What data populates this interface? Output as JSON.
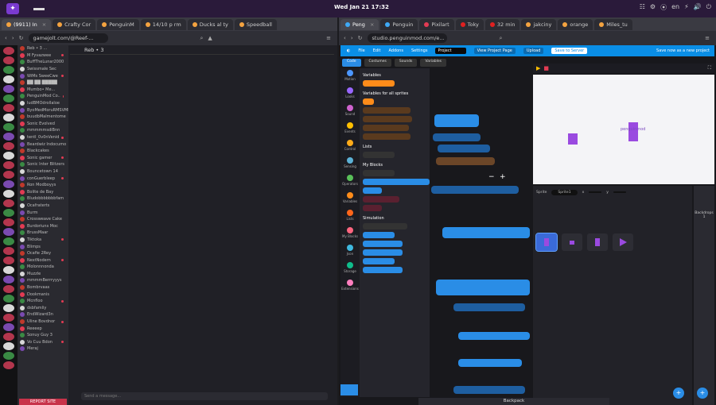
{
  "topbar": {
    "clock": "Wed Jan 21 17:32",
    "tray_items": [
      "☷",
      "⚙",
      "⦿",
      "en",
      "⚡",
      "🔊",
      "⏻"
    ]
  },
  "left_browser": {
    "tabs": [
      {
        "label": "(9911) In",
        "active": true
      },
      {
        "label": "Crafty Cor",
        "active": false
      },
      {
        "label": "PenguinM",
        "active": false
      },
      {
        "label": "14/10 p rm",
        "active": false
      },
      {
        "label": "Ducks al ty",
        "active": false
      },
      {
        "label": "Speedball",
        "active": false
      }
    ],
    "url": "gamejolt.com/@Reef-...",
    "channel_header": "Reb • 3",
    "channels": [
      "Reb • 3 ...",
      "M Fyvazwee",
      "BuffTheLunar2000",
      "Swissmale Sec",
      "WiMs SweeCwe",
      "██ ██ █████",
      "Mumbo• Me...",
      "PenguinMod Co..",
      "ludBMOdrollaloe",
      "ByoMedMoruRMSVMB",
      "buudbMalmentome",
      "Sonic Evolved",
      "mmmmmsdiBnn",
      "tentl_0v0nVenid",
      "Beardwiz Indocumo",
      "Blackcakes",
      "Sonic gamer",
      "Sonic Inter Blitzers",
      "Bouncetown 14",
      "conGuerbleep",
      "Ron Modboyys",
      "Bolite de Bay",
      "Bludobbbbbbbfam",
      "Ocafraterts",
      "Burm",
      "Crossweave Cake",
      "Burdoriuns Moc",
      "BrussMaar",
      "Tiktoka",
      "Blimps",
      "Ocafie 2Rey",
      "NextNodern",
      "Molonnnonda",
      "Muzzle",
      "mmmmBerrryyys",
      "Bombrvaas",
      "Dookmanis",
      "Mcnfloo",
      "dsbfamliy",
      "EndWizard3n",
      "Uline Bovdnor",
      "Reeeep",
      "Sonuy Guy 3",
      "Vo Cuu Bdon",
      "Meraj"
    ],
    "chat_placeholder": "Send a message...",
    "bottom_button": "REPORT SITE"
  },
  "right_browser": {
    "tabs": [
      {
        "label": "Peng",
        "active": true
      },
      {
        "label": "Penguin",
        "active": false
      },
      {
        "label": "Pixilart",
        "active": false
      },
      {
        "label": "Toky",
        "active": false
      },
      {
        "label": "32 min",
        "active": false
      },
      {
        "label": "jakciny",
        "active": false
      },
      {
        "label": "orange",
        "active": false
      },
      {
        "label": "Miles_tu",
        "active": false
      }
    ],
    "url": "studio.penguinmod.com/e...",
    "menu": {
      "items": [
        "Pm",
        "File",
        "Edit",
        "Addons",
        "Settings"
      ],
      "project_title": "Project",
      "buttons": [
        "View Project Page",
        "Upload",
        "Save to Server"
      ],
      "right_link": "Save now as a new project"
    },
    "editor_tabs": [
      "Code",
      "Costumes",
      "Sounds",
      "Variables"
    ],
    "categories": [
      {
        "label": "Motion",
        "color": "#4c97ff"
      },
      {
        "label": "Looks",
        "color": "#9966ff"
      },
      {
        "label": "Sound",
        "color": "#cf63cf"
      },
      {
        "label": "Events",
        "color": "#ffbf00"
      },
      {
        "label": "Control",
        "color": "#ffab19"
      },
      {
        "label": "Sensing",
        "color": "#5cb1d6"
      },
      {
        "label": "Operators",
        "color": "#59c059"
      },
      {
        "label": "Variables",
        "color": "#ff8c1a"
      },
      {
        "label": "Lists",
        "color": "#ff661a"
      },
      {
        "label": "My Blocks",
        "color": "#ff6680"
      },
      {
        "label": "Json",
        "color": "#3fb9e0"
      },
      {
        "label": "Storage",
        "color": "#0fbd8c"
      },
      {
        "label": "Extensions",
        "color": "#ff7fbf"
      }
    ],
    "palette_headers": [
      "Variables",
      "Variables for all sprites",
      "Lists",
      "My Blocks",
      "Simulation"
    ],
    "stage_text": "penguinmod",
    "sprite_info": {
      "sprite_label": "Sprite",
      "sprite_name": "Sprite1",
      "x_label": "x",
      "y_label": "y"
    },
    "stage_panel": {
      "label": "Backdrops",
      "count": "1"
    },
    "bottom_bar": "Backpack"
  }
}
